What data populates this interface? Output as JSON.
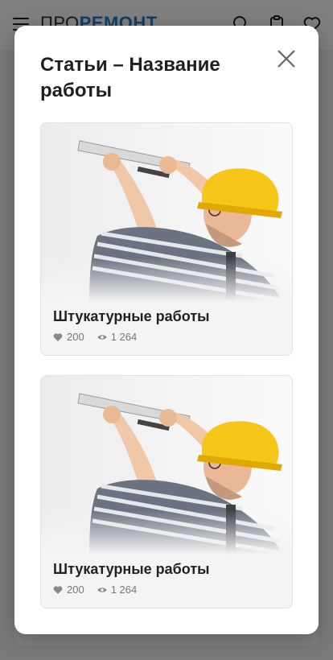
{
  "header": {
    "logo_part1": "ПРО",
    "logo_part2": "РЕМОНТ",
    "icons": [
      "menu-icon",
      "search-icon",
      "clipboard-icon",
      "heart-icon"
    ]
  },
  "modal": {
    "title": "Статьи – Название работы",
    "close_icon": "close-icon",
    "cards": [
      {
        "title": "Штукатурные работы",
        "likes": "200",
        "views": "1 264"
      },
      {
        "title": "Штукатурные работы",
        "likes": "200",
        "views": "1 264"
      }
    ]
  },
  "colors": {
    "accent": "#1e7fd0",
    "overlay": "rgba(0,0,0,0.5)",
    "helmet": "#f5c518"
  }
}
